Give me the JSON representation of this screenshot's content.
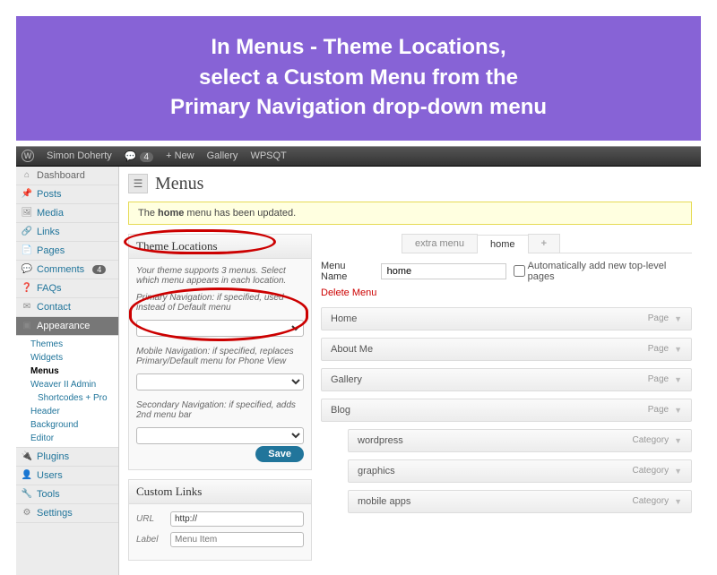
{
  "banner": {
    "line1": "In Menus - Theme Locations,",
    "line2": "select a Custom Menu from the",
    "line3": "Primary Navigation drop-down menu"
  },
  "adminbar": {
    "site": "Simon Doherty",
    "comments": "4",
    "new": "+ New",
    "items": [
      "Gallery",
      "WPSQT"
    ]
  },
  "sidebar": {
    "dashboard": "Dashboard",
    "items": [
      {
        "label": "Posts",
        "icon": "📌"
      },
      {
        "label": "Media",
        "icon": "🖼"
      },
      {
        "label": "Links",
        "icon": "🔗"
      },
      {
        "label": "Pages",
        "icon": "📄"
      },
      {
        "label": "Comments",
        "icon": "💬",
        "badge": "4"
      },
      {
        "label": "FAQs",
        "icon": "❓"
      },
      {
        "label": "Contact",
        "icon": "✉"
      }
    ],
    "appearance": "Appearance",
    "appearance_sub": [
      "Themes",
      "Widgets",
      "Menus",
      "Weaver II Admin",
      "Shortcodes + Pro",
      "Header",
      "Background",
      "Editor"
    ],
    "appearance_selected": "Menus",
    "bottom": [
      {
        "label": "Plugins",
        "icon": "🔌"
      },
      {
        "label": "Users",
        "icon": "👤"
      },
      {
        "label": "Tools",
        "icon": "🔧"
      },
      {
        "label": "Settings",
        "icon": "⚙"
      }
    ]
  },
  "page": {
    "title": "Menus",
    "notice_pre": "The ",
    "notice_bold": "home",
    "notice_post": " menu has been updated."
  },
  "theme_locations": {
    "heading": "Theme Locations",
    "intro": "Your theme supports 3 menus. Select which menu appears in each location.",
    "primary_label": "Primary Navigation: if specified, used instead of Default menu",
    "mobile_label": "Mobile Navigation: if specified, replaces Primary/Default menu for Phone View",
    "secondary_label": "Secondary Navigation: if specified, adds 2nd menu bar",
    "save": "Save"
  },
  "custom_links": {
    "heading": "Custom Links",
    "url_label": "URL",
    "url_value": "http://",
    "label_label": "Label",
    "label_placeholder": "Menu Item"
  },
  "tabs": {
    "extra": "extra menu",
    "home": "home",
    "add": "+"
  },
  "menu": {
    "name_label": "Menu Name",
    "name_value": "home",
    "auto_add": "Automatically add new top-level pages",
    "delete": "Delete Menu",
    "items": [
      {
        "label": "Home",
        "type": "Page",
        "indent": 0
      },
      {
        "label": "About Me",
        "type": "Page",
        "indent": 0
      },
      {
        "label": "Gallery",
        "type": "Page",
        "indent": 0
      },
      {
        "label": "Blog",
        "type": "Page",
        "indent": 0
      },
      {
        "label": "wordpress",
        "type": "Category",
        "indent": 1
      },
      {
        "label": "graphics",
        "type": "Category",
        "indent": 1
      },
      {
        "label": "mobile apps",
        "type": "Category",
        "indent": 1
      }
    ]
  }
}
